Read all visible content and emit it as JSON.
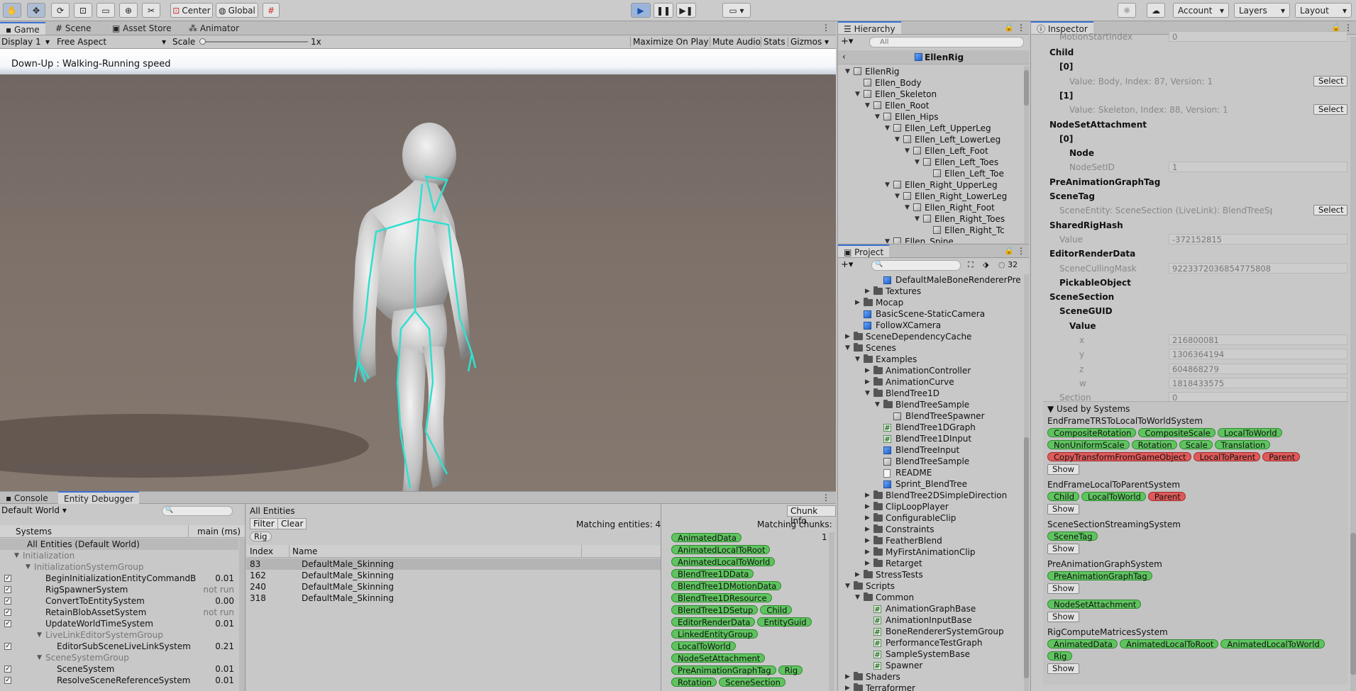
{
  "toolbar": {
    "center_label": "Center",
    "global_label": "Global",
    "account_label": "Account",
    "layers_label": "Layers",
    "layout_label": "Layout"
  },
  "game_tabs": [
    "Game",
    "Scene",
    "Asset Store",
    "Animator"
  ],
  "game_bar": {
    "display": "Display 1",
    "aspect": "Free Aspect",
    "scale_label": "Scale",
    "scale_value": "1x",
    "maximize": "Maximize On Play",
    "mute": "Mute Audio",
    "stats": "Stats",
    "gizmos": "Gizmos"
  },
  "viewport": {
    "caption": "Down-Up : Walking-Running speed"
  },
  "bottom_tabs": [
    "Console",
    "Entity Debugger"
  ],
  "entity_debugger": {
    "world": "Default World",
    "systems_header": "Systems",
    "time_header": "main (ms)",
    "all_entities_label": "All Entities",
    "chunk_info": "Chunk Info",
    "filter": "Filter",
    "clear": "Clear",
    "matching_entities": "Matching entities: 4",
    "matching_chunks": "Matching chunks: 1",
    "rig_chip": "Rig",
    "chunk_count": "1",
    "index_header": "Index",
    "name_header": "Name",
    "systems": [
      {
        "name": "All Entities (Default World)",
        "time": "",
        "indent": 0,
        "kind": "root"
      },
      {
        "name": "Initialization",
        "time": "",
        "indent": 1,
        "kind": "group"
      },
      {
        "name": "InitializationSystemGroup",
        "time": "",
        "indent": 2,
        "kind": "group"
      },
      {
        "name": "BeginInitializationEntityCommandB",
        "time": "0.01",
        "indent": 3,
        "kind": "sys"
      },
      {
        "name": "RigSpawnerSystem",
        "time": "not run",
        "indent": 3,
        "kind": "sys"
      },
      {
        "name": "ConvertToEntitySystem",
        "time": "0.00",
        "indent": 3,
        "kind": "sys"
      },
      {
        "name": "RetainBlobAssetSystem",
        "time": "not run",
        "indent": 3,
        "kind": "sys"
      },
      {
        "name": "UpdateWorldTimeSystem",
        "time": "0.01",
        "indent": 3,
        "kind": "sys"
      },
      {
        "name": "LiveLinkEditorSystemGroup",
        "time": "",
        "indent": 3,
        "kind": "group"
      },
      {
        "name": "EditorSubSceneLiveLinkSystem",
        "time": "0.21",
        "indent": 4,
        "kind": "sys"
      },
      {
        "name": "SceneSystemGroup",
        "time": "",
        "indent": 3,
        "kind": "group"
      },
      {
        "name": "SceneSystem",
        "time": "0.01",
        "indent": 4,
        "kind": "sys"
      },
      {
        "name": "ResolveSceneReferenceSystem",
        "time": "0.01",
        "indent": 4,
        "kind": "sys"
      }
    ],
    "entities": [
      {
        "index": "83",
        "name": "DefaultMale_Skinning"
      },
      {
        "index": "162",
        "name": "DefaultMale_Skinning"
      },
      {
        "index": "240",
        "name": "DefaultMale_Skinning"
      },
      {
        "index": "318",
        "name": "DefaultMale_Skinning"
      }
    ],
    "components": [
      [
        "AnimatedData"
      ],
      [
        "AnimatedLocalToRoot"
      ],
      [
        "AnimatedLocalToWorld"
      ],
      [
        "BlendTree1DData"
      ],
      [
        "BlendTree1DMotionData"
      ],
      [
        "BlendTree1DResource"
      ],
      [
        "BlendTree1DSetup",
        "Child"
      ],
      [
        "EditorRenderData",
        "EntityGuid"
      ],
      [
        "LinkedEntityGroup"
      ],
      [
        "LocalToWorld"
      ],
      [
        "NodeSetAttachment"
      ],
      [
        "PreAnimationGraphTag",
        "Rig"
      ],
      [
        "Rotation",
        "SceneSection"
      ]
    ]
  },
  "hierarchy": {
    "title": "Hierarchy",
    "search_placeholder": "All",
    "root": "EllenRig",
    "items": [
      {
        "label": "EllenRig",
        "indent": 0,
        "arrow": "▼"
      },
      {
        "label": "Ellen_Body",
        "indent": 1,
        "arrow": ""
      },
      {
        "label": "Ellen_Skeleton",
        "indent": 1,
        "arrow": "▼"
      },
      {
        "label": "Ellen_Root",
        "indent": 2,
        "arrow": "▼"
      },
      {
        "label": "Ellen_Hips",
        "indent": 3,
        "arrow": "▼"
      },
      {
        "label": "Ellen_Left_UpperLeg",
        "indent": 4,
        "arrow": "▼"
      },
      {
        "label": "Ellen_Left_LowerLeg",
        "indent": 5,
        "arrow": "▼"
      },
      {
        "label": "Ellen_Left_Foot",
        "indent": 6,
        "arrow": "▼"
      },
      {
        "label": "Ellen_Left_Toes",
        "indent": 7,
        "arrow": "▼"
      },
      {
        "label": "Ellen_Left_Toe",
        "indent": 8,
        "arrow": ""
      },
      {
        "label": "Ellen_Right_UpperLeg",
        "indent": 4,
        "arrow": "▼"
      },
      {
        "label": "Ellen_Right_LowerLeg",
        "indent": 5,
        "arrow": "▼"
      },
      {
        "label": "Ellen_Right_Foot",
        "indent": 6,
        "arrow": "▼"
      },
      {
        "label": "Ellen_Right_Toes",
        "indent": 7,
        "arrow": "▼"
      },
      {
        "label": "Ellen_Right_Tc",
        "indent": 8,
        "arrow": ""
      },
      {
        "label": "Ellen_Spine",
        "indent": 4,
        "arrow": "▼"
      }
    ]
  },
  "project": {
    "title": "Project",
    "hidden_count": "32",
    "items": [
      {
        "label": "DefaultMaleBoneRendererPre",
        "indent": 3,
        "arrow": "",
        "icon": "cube-blue"
      },
      {
        "label": "Textures",
        "indent": 2,
        "arrow": "▶",
        "icon": "folder"
      },
      {
        "label": "Mocap",
        "indent": 1,
        "arrow": "▶",
        "icon": "folder"
      },
      {
        "label": "BasicScene-StaticCamera",
        "indent": 1,
        "arrow": "",
        "icon": "cube-blue"
      },
      {
        "label": "FollowXCamera",
        "indent": 1,
        "arrow": "",
        "icon": "cube-blue"
      },
      {
        "label": "SceneDependencyCache",
        "indent": 0,
        "arrow": "▶",
        "icon": "folder"
      },
      {
        "label": "Scenes",
        "indent": 0,
        "arrow": "▼",
        "icon": "folder"
      },
      {
        "label": "Examples",
        "indent": 1,
        "arrow": "▼",
        "icon": "folder"
      },
      {
        "label": "AnimationController",
        "indent": 2,
        "arrow": "▶",
        "icon": "folder"
      },
      {
        "label": "AnimationCurve",
        "indent": 2,
        "arrow": "▶",
        "icon": "folder"
      },
      {
        "label": "BlendTree1D",
        "indent": 2,
        "arrow": "▼",
        "icon": "folder"
      },
      {
        "label": "BlendTreeSample",
        "indent": 3,
        "arrow": "▼",
        "icon": "folder"
      },
      {
        "label": "BlendTreeSpawner",
        "indent": 4,
        "arrow": "",
        "icon": "graph"
      },
      {
        "label": "BlendTree1DGraph",
        "indent": 3,
        "arrow": "",
        "icon": "hash"
      },
      {
        "label": "BlendTree1DInput",
        "indent": 3,
        "arrow": "",
        "icon": "hash"
      },
      {
        "label": "BlendTreeInput",
        "indent": 3,
        "arrow": "",
        "icon": "cube-blue"
      },
      {
        "label": "BlendTreeSample",
        "indent": 3,
        "arrow": "",
        "icon": "unity"
      },
      {
        "label": "README",
        "indent": 3,
        "arrow": "",
        "icon": "doc"
      },
      {
        "label": "Sprint_BlendTree",
        "indent": 3,
        "arrow": "",
        "icon": "cube-blue"
      },
      {
        "label": "BlendTree2DSimpleDirection",
        "indent": 2,
        "arrow": "▶",
        "icon": "folder"
      },
      {
        "label": "ClipLoopPlayer",
        "indent": 2,
        "arrow": "▶",
        "icon": "folder"
      },
      {
        "label": "ConfigurableClip",
        "indent": 2,
        "arrow": "▶",
        "icon": "folder"
      },
      {
        "label": "Constraints",
        "indent": 2,
        "arrow": "▶",
        "icon": "folder"
      },
      {
        "label": "FeatherBlend",
        "indent": 2,
        "arrow": "▶",
        "icon": "folder"
      },
      {
        "label": "MyFirstAnimationClip",
        "indent": 2,
        "arrow": "▶",
        "icon": "folder"
      },
      {
        "label": "Retarget",
        "indent": 2,
        "arrow": "▶",
        "icon": "folder"
      },
      {
        "label": "StressTests",
        "indent": 1,
        "arrow": "▶",
        "icon": "folder"
      },
      {
        "label": "Scripts",
        "indent": 0,
        "arrow": "▼",
        "icon": "folder"
      },
      {
        "label": "Common",
        "indent": 1,
        "arrow": "▼",
        "icon": "folder"
      },
      {
        "label": "AnimationGraphBase",
        "indent": 2,
        "arrow": "",
        "icon": "hash"
      },
      {
        "label": "AnimationInputBase",
        "indent": 2,
        "arrow": "",
        "icon": "hash"
      },
      {
        "label": "BoneRendererSystemGroup",
        "indent": 2,
        "arrow": "",
        "icon": "hash"
      },
      {
        "label": "PerformanceTestGraph",
        "indent": 2,
        "arrow": "",
        "icon": "hash"
      },
      {
        "label": "SampleSystemBase",
        "indent": 2,
        "arrow": "",
        "icon": "hash"
      },
      {
        "label": "Spawner",
        "indent": 2,
        "arrow": "",
        "icon": "hash"
      },
      {
        "label": "Shaders",
        "indent": 0,
        "arrow": "▶",
        "icon": "folder"
      },
      {
        "label": "Terraformer",
        "indent": 0,
        "arrow": "▶",
        "icon": "folder"
      }
    ]
  },
  "inspector": {
    "title": "Inspector",
    "rows": [
      {
        "label": "MotionStartIndex",
        "value": "0",
        "indent": 1,
        "bold": false,
        "dim": true,
        "button": ""
      },
      {
        "label": "Child",
        "value": "",
        "indent": 0,
        "bold": true,
        "dim": false,
        "button": ""
      },
      {
        "label": "[0]",
        "value": "",
        "indent": 1,
        "bold": true,
        "dim": false,
        "button": ""
      },
      {
        "label": "Value: Body, Index: 87, Version: 1",
        "value": "",
        "indent": 2,
        "bold": false,
        "dim": true,
        "button": "Select"
      },
      {
        "label": "[1]",
        "value": "",
        "indent": 1,
        "bold": true,
        "dim": false,
        "button": ""
      },
      {
        "label": "Value: Skeleton, Index: 88, Version: 1",
        "value": "",
        "indent": 2,
        "bold": false,
        "dim": true,
        "button": "Select"
      },
      {
        "label": "NodeSetAttachment",
        "value": "",
        "indent": 0,
        "bold": true,
        "dim": false,
        "button": ""
      },
      {
        "label": "[0]",
        "value": "",
        "indent": 1,
        "bold": true,
        "dim": false,
        "button": ""
      },
      {
        "label": "Node",
        "value": "",
        "indent": 2,
        "bold": true,
        "dim": false,
        "button": ""
      },
      {
        "label": "NodeSetID",
        "value": "1",
        "indent": 2,
        "bold": false,
        "dim": true,
        "button": ""
      },
      {
        "label": "PreAnimationGraphTag",
        "value": "",
        "indent": 0,
        "bold": true,
        "dim": false,
        "button": ""
      },
      {
        "label": "SceneTag",
        "value": "",
        "indent": 0,
        "bold": true,
        "dim": false,
        "button": ""
      },
      {
        "label": "SceneEntity: SceneSection (LiveLink): BlendTreeSpawner, Index",
        "value": "",
        "indent": 1,
        "bold": false,
        "dim": true,
        "button": "Select"
      },
      {
        "label": "SharedRigHash",
        "value": "",
        "indent": 0,
        "bold": true,
        "dim": false,
        "button": ""
      },
      {
        "label": "Value",
        "value": "-372152815",
        "indent": 1,
        "bold": false,
        "dim": true,
        "button": ""
      },
      {
        "label": "EditorRenderData",
        "value": "",
        "indent": 0,
        "bold": true,
        "dim": false,
        "button": ""
      },
      {
        "label": "SceneCullingMask",
        "value": "9223372036854775808",
        "indent": 1,
        "bold": false,
        "dim": true,
        "button": ""
      },
      {
        "label": "PickableObject",
        "value": "",
        "indent": 1,
        "bold": true,
        "dim": false,
        "button": ""
      },
      {
        "label": "SceneSection",
        "value": "",
        "indent": 0,
        "bold": true,
        "dim": false,
        "button": ""
      },
      {
        "label": "SceneGUID",
        "value": "",
        "indent": 1,
        "bold": true,
        "dim": false,
        "button": ""
      },
      {
        "label": "Value",
        "value": "",
        "indent": 2,
        "bold": true,
        "dim": false,
        "button": ""
      },
      {
        "label": "x",
        "value": "216800081",
        "indent": 3,
        "bold": false,
        "dim": true,
        "button": ""
      },
      {
        "label": "y",
        "value": "1306364194",
        "indent": 3,
        "bold": false,
        "dim": true,
        "button": ""
      },
      {
        "label": "z",
        "value": "604868279",
        "indent": 3,
        "bold": false,
        "dim": true,
        "button": ""
      },
      {
        "label": "w",
        "value": "1818433575",
        "indent": 3,
        "bold": false,
        "dim": true,
        "button": ""
      },
      {
        "label": "Section",
        "value": "0",
        "indent": 1,
        "bold": false,
        "dim": true,
        "button": ""
      }
    ],
    "used_by": {
      "title": "Used by Systems",
      "show_label": "Show",
      "systems": [
        {
          "name": "EndFrameTRSToLocalToWorldSystem",
          "chips": [
            [
              "CompositeRotation",
              "g"
            ],
            [
              "CompositeScale",
              "g"
            ],
            [
              "LocalToWorld",
              "g"
            ],
            [
              "NonUniformScale",
              "g"
            ],
            [
              "Rotation",
              "g"
            ],
            [
              "Scale",
              "g"
            ],
            [
              "Translation",
              "g"
            ],
            [
              "CopyTransformFromGameObject",
              "r"
            ],
            [
              "LocalToParent",
              "r"
            ],
            [
              "Parent",
              "r"
            ]
          ],
          "show": true
        },
        {
          "name": "EndFrameLocalToParentSystem",
          "chips": [
            [
              "Child",
              "g"
            ],
            [
              "LocalToWorld",
              "g"
            ],
            [
              "Parent",
              "r"
            ]
          ],
          "show": true
        },
        {
          "name": "SceneSectionStreamingSystem",
          "chips": [
            [
              "SceneTag",
              "g"
            ]
          ],
          "show": true
        },
        {
          "name": "PreAnimationGraphSystem",
          "chips": [
            [
              "PreAnimationGraphTag",
              "g"
            ]
          ],
          "show": true
        },
        {
          "name": "",
          "chips": [
            [
              "NodeSetAttachment",
              "g"
            ]
          ],
          "show": true
        },
        {
          "name": "RigComputeMatricesSystem",
          "chips": [
            [
              "AnimatedData",
              "g"
            ],
            [
              "AnimatedLocalToRoot",
              "g"
            ],
            [
              "AnimatedLocalToWorld",
              "g"
            ],
            [
              "Rig",
              "g"
            ]
          ],
          "show": true
        }
      ]
    }
  },
  "colors": {
    "accent": "#3a72d6",
    "chip_green": "#5fc45f",
    "chip_red": "#e05a5a",
    "skeleton": "#2fe0d0"
  }
}
